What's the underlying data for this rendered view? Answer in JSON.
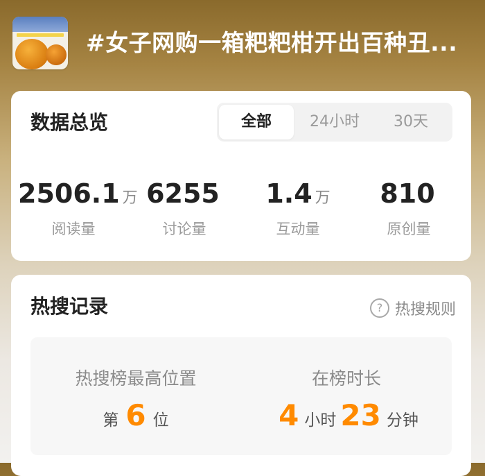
{
  "header": {
    "title": "#女子网购一箱粑粑柑开出百种丑...",
    "thumbnail_icon": "topic-thumbnail"
  },
  "overview": {
    "title": "数据总览",
    "tabs": [
      "全部",
      "24小时",
      "30天"
    ],
    "selected_tab": "全部",
    "stats": [
      {
        "value": "2506.1",
        "unit": "万",
        "label": "阅读量"
      },
      {
        "value": "6255",
        "unit": "",
        "label": "讨论量"
      },
      {
        "value": "1.4",
        "unit": "万",
        "label": "互动量"
      },
      {
        "value": "810",
        "unit": "",
        "label": "原创量"
      }
    ]
  },
  "hot_search": {
    "title": "热搜记录",
    "rules_label": "热搜规则",
    "rules_icon": "question-circle-icon",
    "peak": {
      "label": "热搜榜最高位置",
      "prefix": "第",
      "value": "6",
      "suffix": "位"
    },
    "duration": {
      "label": "在榜时长",
      "hours": "4",
      "hours_unit": "小时",
      "minutes": "23",
      "minutes_unit": "分钟"
    },
    "accent_color": "#ff8a00"
  }
}
